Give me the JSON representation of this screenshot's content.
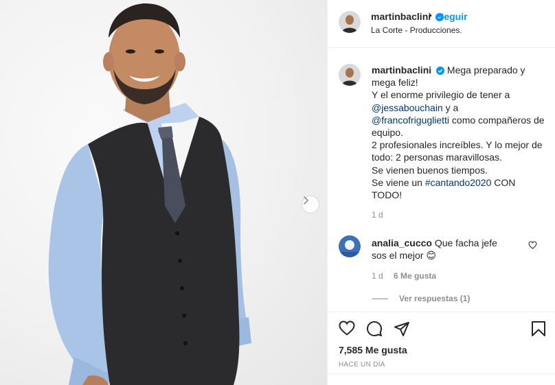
{
  "post": {
    "author": "martinbaclini",
    "follow_label": "Seguir",
    "dot": "•",
    "location": "La Corte - Producciones.",
    "more_label": "..."
  },
  "caption": {
    "username": "martinbaclini",
    "line1": "Mega preparado y mega feliz!",
    "line2": "Y el enorme privilegio de tener a",
    "mention1": "@jessabouchain",
    "and": " y a",
    "mention2": "@francofriguglietti",
    "line3": " como compañeros de equipo.",
    "line4": "2 profesionales increíbles. Y lo mejor de todo: 2 personas maravillosas.",
    "line5": "Se vienen buenos tiempos.",
    "line6_pre": "Se viene un ",
    "hashtag": "#cantando2020",
    "line6_post": " CON TODO!",
    "time": "1 d"
  },
  "comment": {
    "username": "analia_cucco",
    "text": "Que facha jefe sos el mejor",
    "emoji": "😊",
    "time": "1 d",
    "likes": "6 Me gusta",
    "replies_label": "Ver respuestas (1)"
  },
  "footer": {
    "likes_total": "7,585 Me gusta",
    "posted": "HACE UN DÍA"
  },
  "icons": {
    "verified": "verified-badge-icon",
    "next": "chevron-right-icon",
    "like": "heart-icon",
    "comment": "comment-icon",
    "share": "paper-plane-icon",
    "save": "bookmark-icon"
  },
  "colors": {
    "accent": "#0095f6",
    "mention": "#00376b",
    "muted": "#8e8e8e",
    "text": "#262626"
  }
}
